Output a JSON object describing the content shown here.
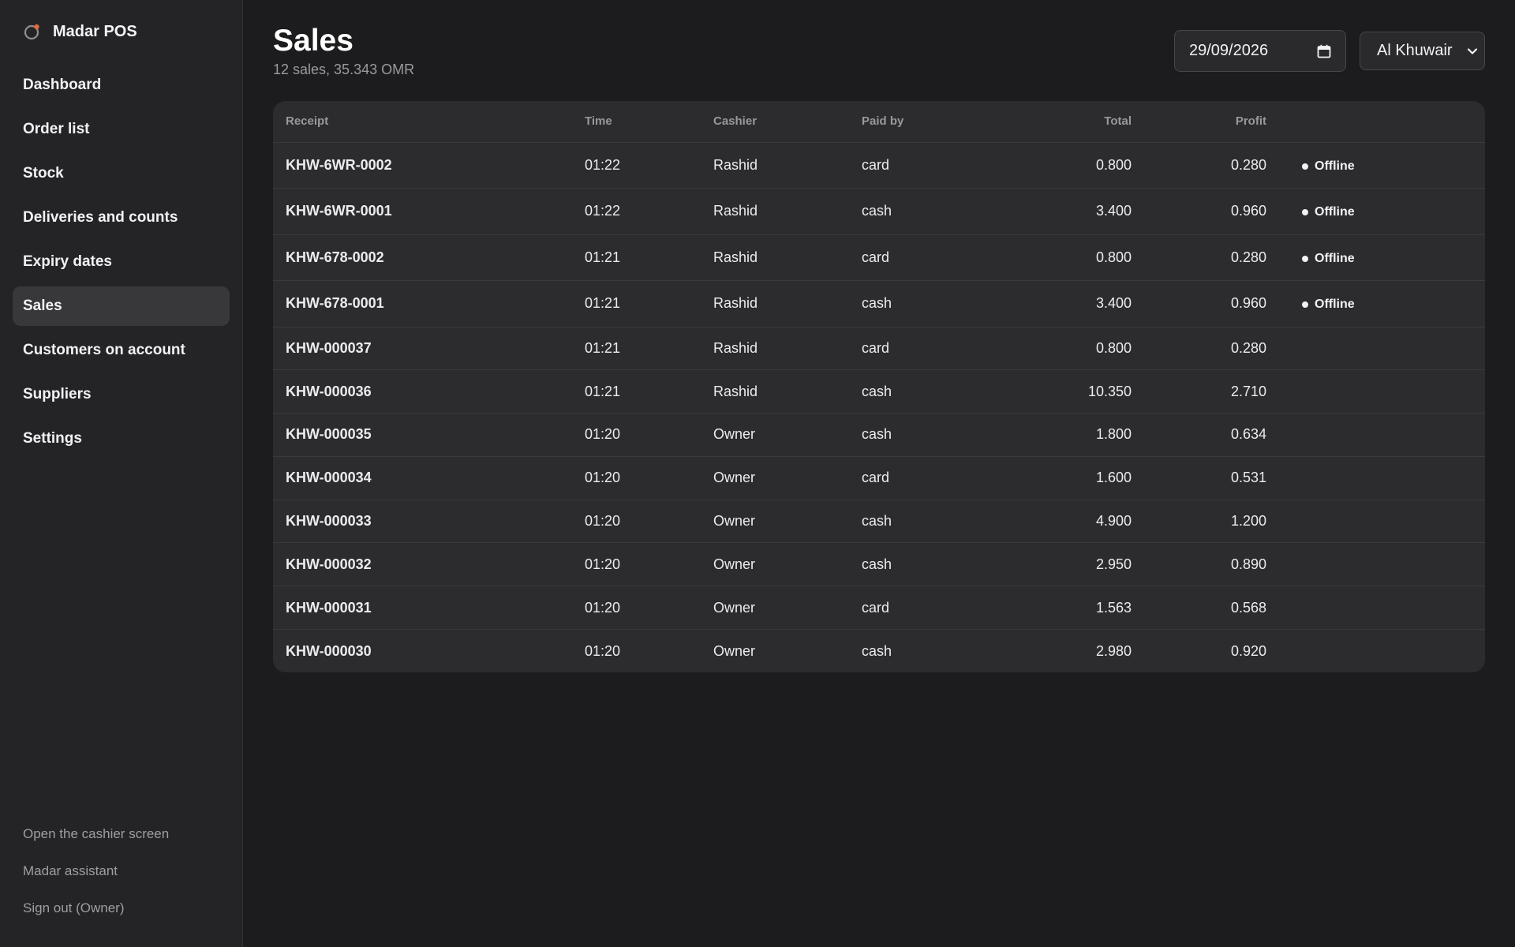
{
  "app": {
    "name": "Madar POS"
  },
  "sidebar": {
    "items": [
      {
        "label": "Dashboard",
        "name": "sidebar-item-dashboard"
      },
      {
        "label": "Order list",
        "name": "sidebar-item-order-list"
      },
      {
        "label": "Stock",
        "name": "sidebar-item-stock"
      },
      {
        "label": "Deliveries and counts",
        "name": "sidebar-item-deliveries"
      },
      {
        "label": "Expiry dates",
        "name": "sidebar-item-expiry"
      },
      {
        "label": "Sales",
        "name": "sidebar-item-sales",
        "active": true
      },
      {
        "label": "Customers on account",
        "name": "sidebar-item-customers"
      },
      {
        "label": "Suppliers",
        "name": "sidebar-item-suppliers"
      },
      {
        "label": "Settings",
        "name": "sidebar-item-settings"
      }
    ],
    "footer": {
      "cashier": "Open the cashier screen",
      "assistant": "Madar assistant",
      "signout": "Sign out (Owner)"
    }
  },
  "page": {
    "title": "Sales",
    "subtitle": "12 sales, 35.343 OMR",
    "date_value": "29/09/2026",
    "branch": "Al Khuwair"
  },
  "table": {
    "headers": {
      "receipt": "Receipt",
      "time": "Time",
      "cashier": "Cashier",
      "paid_by": "Paid by",
      "total": "Total",
      "profit": "Profit"
    },
    "rows": [
      {
        "receipt": "KHW-6WR-0002",
        "time": "01:22",
        "cashier": "Rashid",
        "paid_by": "card",
        "total": "0.800",
        "profit": "0.280",
        "status": "Offline"
      },
      {
        "receipt": "KHW-6WR-0001",
        "time": "01:22",
        "cashier": "Rashid",
        "paid_by": "cash",
        "total": "3.400",
        "profit": "0.960",
        "status": "Offline"
      },
      {
        "receipt": "KHW-678-0002",
        "time": "01:21",
        "cashier": "Rashid",
        "paid_by": "card",
        "total": "0.800",
        "profit": "0.280",
        "status": "Offline"
      },
      {
        "receipt": "KHW-678-0001",
        "time": "01:21",
        "cashier": "Rashid",
        "paid_by": "cash",
        "total": "3.400",
        "profit": "0.960",
        "status": "Offline"
      },
      {
        "receipt": "KHW-000037",
        "time": "01:21",
        "cashier": "Rashid",
        "paid_by": "card",
        "total": "0.800",
        "profit": "0.280",
        "status": ""
      },
      {
        "receipt": "KHW-000036",
        "time": "01:21",
        "cashier": "Rashid",
        "paid_by": "cash",
        "total": "10.350",
        "profit": "2.710",
        "status": ""
      },
      {
        "receipt": "KHW-000035",
        "time": "01:20",
        "cashier": "Owner",
        "paid_by": "cash",
        "total": "1.800",
        "profit": "0.634",
        "status": ""
      },
      {
        "receipt": "KHW-000034",
        "time": "01:20",
        "cashier": "Owner",
        "paid_by": "card",
        "total": "1.600",
        "profit": "0.531",
        "status": ""
      },
      {
        "receipt": "KHW-000033",
        "time": "01:20",
        "cashier": "Owner",
        "paid_by": "cash",
        "total": "4.900",
        "profit": "1.200",
        "status": ""
      },
      {
        "receipt": "KHW-000032",
        "time": "01:20",
        "cashier": "Owner",
        "paid_by": "cash",
        "total": "2.950",
        "profit": "0.890",
        "status": ""
      },
      {
        "receipt": "KHW-000031",
        "time": "01:20",
        "cashier": "Owner",
        "paid_by": "card",
        "total": "1.563",
        "profit": "0.568",
        "status": ""
      },
      {
        "receipt": "KHW-000030",
        "time": "01:20",
        "cashier": "Owner",
        "paid_by": "cash",
        "total": "2.980",
        "profit": "0.920",
        "status": ""
      }
    ]
  },
  "icons": {
    "logo": "madar-logo-icon",
    "calendar": "calendar-icon",
    "dropdown": "chevron-down-icon"
  },
  "colors": {
    "background": "#1c1c1e",
    "sidebar": "#242426",
    "card": "#2c2c2e",
    "active_nav": "#38383b",
    "logo_accent": "#e06a3a"
  }
}
